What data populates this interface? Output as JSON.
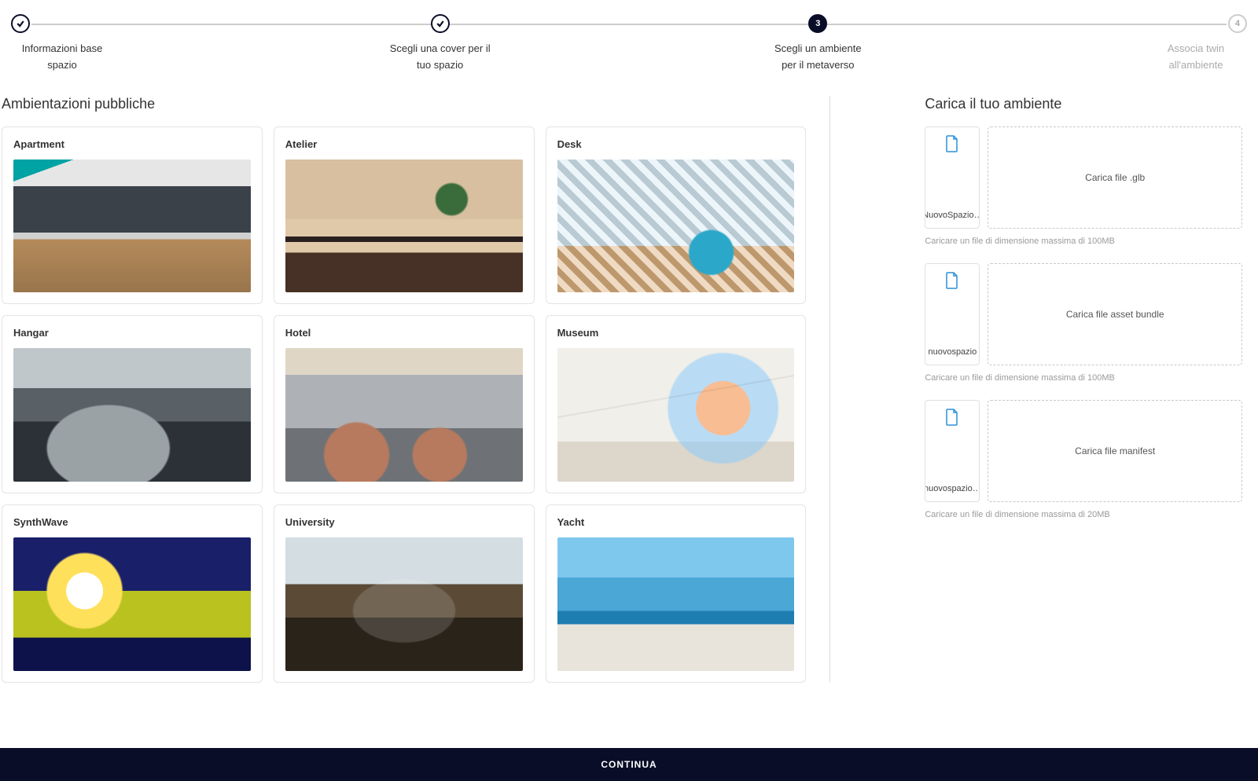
{
  "steps": [
    {
      "label": "Informazioni base spazio",
      "state": "done"
    },
    {
      "label": "Scegli una cover per il tuo spazio",
      "state": "done"
    },
    {
      "label": "Scegli un ambiente per il metaverso",
      "state": "active",
      "num": "3"
    },
    {
      "label": "Associa twin all'ambiente",
      "state": "disabled",
      "num": "4"
    }
  ],
  "left_title": "Ambientazioni pubbliche",
  "environments": [
    {
      "name": "Apartment",
      "thumb": "t-apartment"
    },
    {
      "name": "Atelier",
      "thumb": "t-atelier"
    },
    {
      "name": "Desk",
      "thumb": "t-desk"
    },
    {
      "name": "Hangar",
      "thumb": "t-hangar"
    },
    {
      "name": "Hotel",
      "thumb": "t-hotel"
    },
    {
      "name": "Museum",
      "thumb": "t-museum"
    },
    {
      "name": "SynthWave",
      "thumb": "t-synth"
    },
    {
      "name": "University",
      "thumb": "t-university"
    },
    {
      "name": "Yacht",
      "thumb": "t-yacht"
    }
  ],
  "right_title": "Carica il tuo ambiente",
  "uploads": [
    {
      "filename": "NuovoSpazio…",
      "drop_label": "Carica file .glb",
      "hint": "Caricare un file di dimensione massima di 100MB"
    },
    {
      "filename": "nuovospazio",
      "drop_label": "Carica file asset bundle",
      "hint": "Caricare un file di dimensione massima di 100MB"
    },
    {
      "filename": "nuovospazio…",
      "drop_label": "Carica file manifest",
      "hint": "Caricare un file di dimensione massima di 20MB"
    }
  ],
  "footer_label": "CONTINUA"
}
